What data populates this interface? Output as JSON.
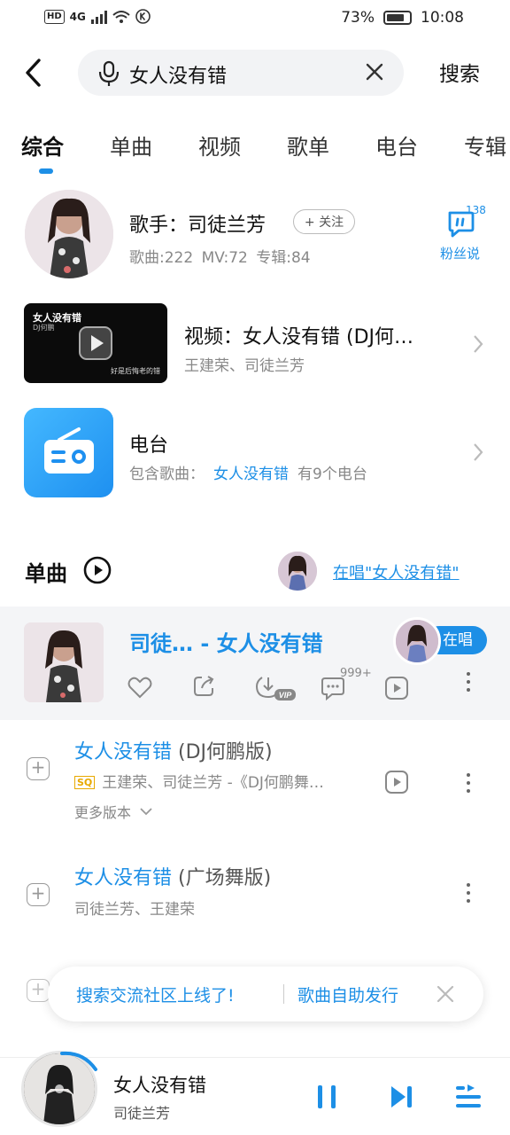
{
  "status_bar": {
    "left_icons": "HD 4G",
    "battery": "73%",
    "time": "10:08"
  },
  "search": {
    "query": "女人没有错",
    "button_label": "搜索"
  },
  "tabs": [
    "综合",
    "单曲",
    "视频",
    "歌单",
    "电台",
    "专辑"
  ],
  "singer": {
    "title": "歌手：司徒兰芳",
    "follow_label": "+ 关注",
    "stats": "歌曲:222  MV:72  专辑:84",
    "fan_count": "138",
    "fan_label": "粉丝说"
  },
  "video": {
    "thumb_title": "女人没有错",
    "thumb_subtitle": "DJ何鹏",
    "thumb_caption": "好是后悔老的错",
    "title": "视频：女人没有错 (DJ何…",
    "artists": "王建荣、司徒兰芳"
  },
  "radio": {
    "title": "电台",
    "prefix": "包含歌曲：",
    "highlight": "女人没有错",
    "suffix": "有9个电台"
  },
  "singles": {
    "section_title": "单曲",
    "singing_link": "在唱\"女人没有错\"",
    "highlight_song": {
      "title": "司徒… - 女人没有错",
      "badge": "在唱",
      "comment_count": "999+",
      "vip_label": "VIP"
    },
    "songs": [
      {
        "title": "女人没有错",
        "version": "(DJ何鹏版)",
        "quality": "SQ",
        "sub": "王建荣、司徒兰芳 -《DJ何鹏舞…",
        "more_versions": "更多版本"
      },
      {
        "title": "女人没有错",
        "version": "(广场舞版)",
        "sub": "司徒兰芳、王建荣"
      }
    ]
  },
  "banner": {
    "left": "搜索交流社区上线了!",
    "right": "歌曲自助发行"
  },
  "player": {
    "title": "女人没有错",
    "artist": "司徒兰芳"
  },
  "colors": {
    "accent": "#1d8fe6"
  }
}
